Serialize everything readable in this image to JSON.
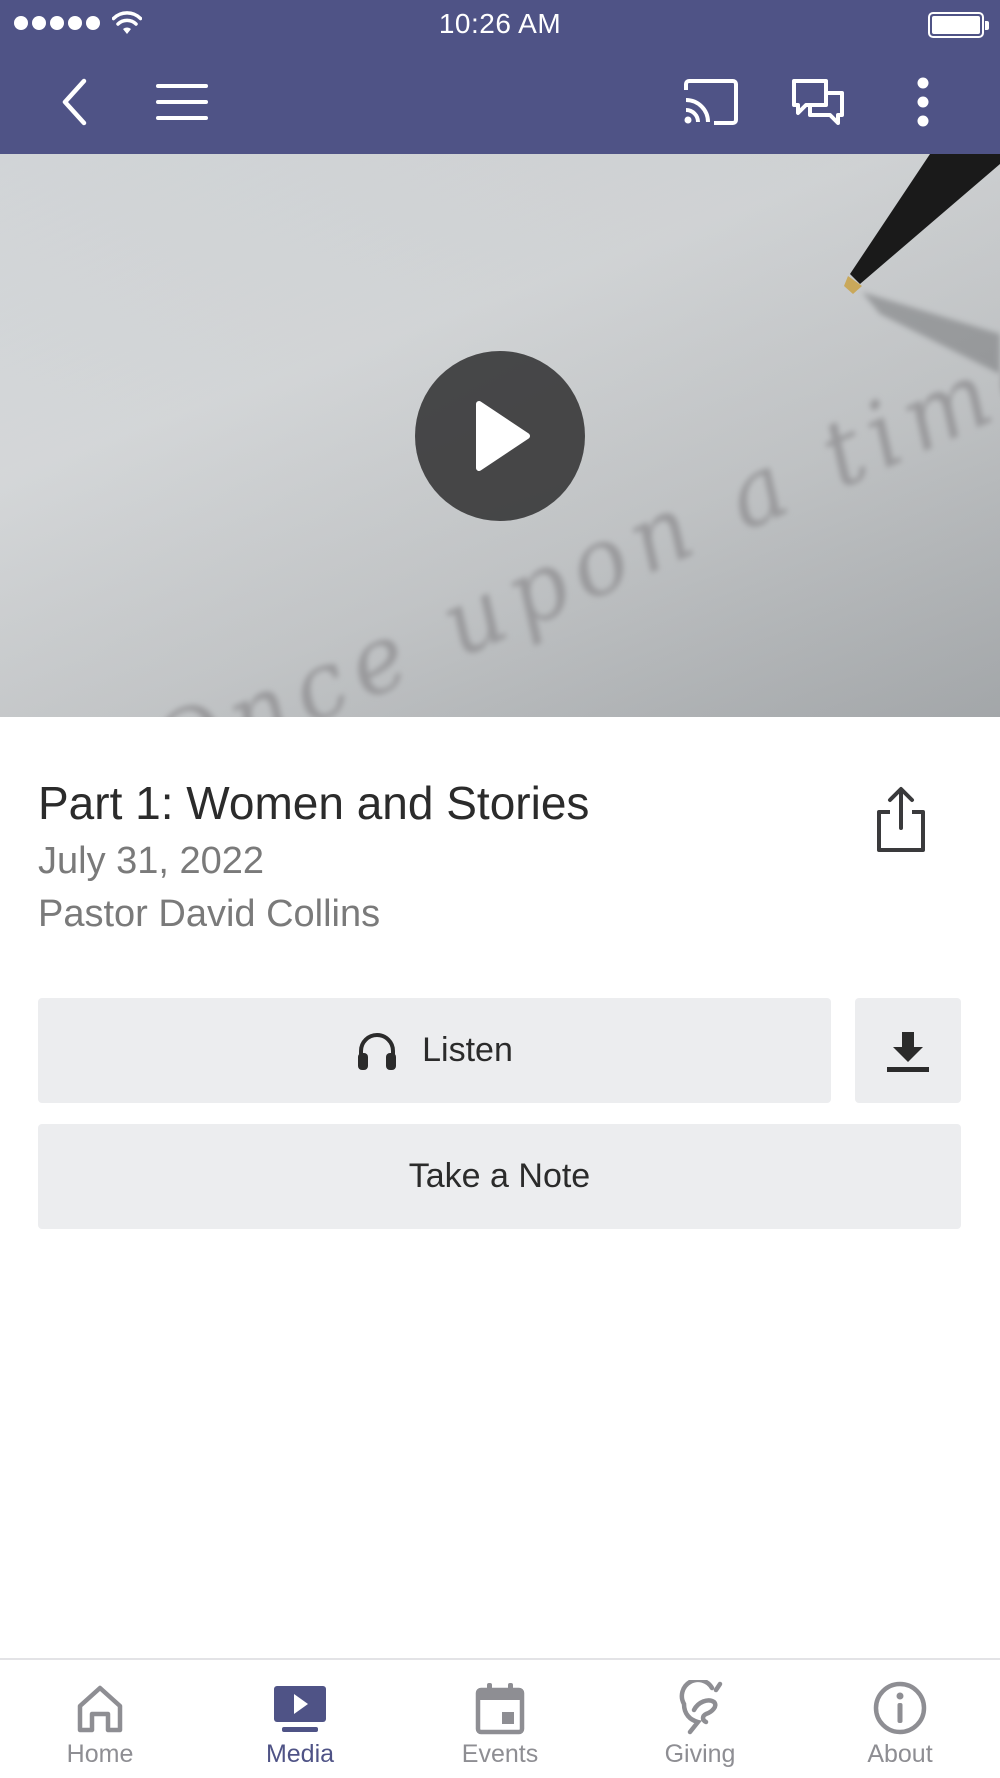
{
  "status_bar": {
    "time": "10:26 AM"
  },
  "header": {
    "icons": [
      "back-icon",
      "menu-icon",
      "cast-icon",
      "chat-icon",
      "more-icon"
    ],
    "background_color": "#4f5386"
  },
  "media": {
    "thumbnail_text": "Once upon a time",
    "play_icon": "play-icon"
  },
  "sermon": {
    "title": "Part 1: Women and Stories",
    "date": "July 31, 2022",
    "speaker": "Pastor David Collins"
  },
  "actions": {
    "listen_label": "Listen",
    "listen_icon": "headphones-icon",
    "download_icon": "download-icon",
    "share_icon": "share-icon",
    "note_label": "Take a Note"
  },
  "tabs": [
    {
      "label": "Home",
      "icon": "home-icon",
      "active": false
    },
    {
      "label": "Media",
      "icon": "media-icon",
      "active": true
    },
    {
      "label": "Events",
      "icon": "calendar-icon",
      "active": false
    },
    {
      "label": "Giving",
      "icon": "giving-icon",
      "active": false
    },
    {
      "label": "About",
      "icon": "info-icon",
      "active": false
    }
  ],
  "colors": {
    "accent": "#4f5386",
    "inactive_tab": "#8e8e93",
    "button_bg": "#ecedef"
  }
}
